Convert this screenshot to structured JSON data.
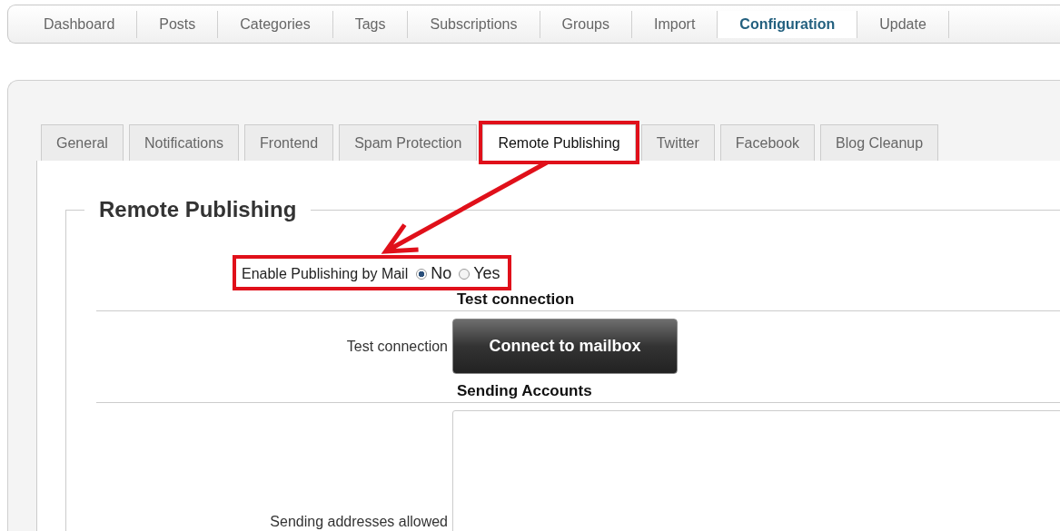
{
  "nav": [
    {
      "label": "Dashboard",
      "selected": false
    },
    {
      "label": "Posts",
      "selected": false
    },
    {
      "label": "Categories",
      "selected": false
    },
    {
      "label": "Tags",
      "selected": false
    },
    {
      "label": "Subscriptions",
      "selected": false
    },
    {
      "label": "Groups",
      "selected": false
    },
    {
      "label": "Import",
      "selected": false
    },
    {
      "label": "Configuration",
      "selected": true
    },
    {
      "label": "Update",
      "selected": false
    }
  ],
  "settings_tabs": [
    {
      "label": "General",
      "selected": false,
      "highlighted": false
    },
    {
      "label": "Notifications",
      "selected": false,
      "highlighted": false
    },
    {
      "label": "Frontend",
      "selected": false,
      "highlighted": false
    },
    {
      "label": "Spam Protection",
      "selected": false,
      "highlighted": false
    },
    {
      "label": "Remote Publishing",
      "selected": true,
      "highlighted": true
    },
    {
      "label": "Twitter",
      "selected": false,
      "highlighted": false
    },
    {
      "label": "Facebook",
      "selected": false,
      "highlighted": false
    },
    {
      "label": "Blog Cleanup",
      "selected": false,
      "highlighted": false
    }
  ],
  "fieldset": {
    "legend": "Remote Publishing"
  },
  "enable_field": {
    "label": "Enable Publishing by Mail",
    "highlighted": true,
    "options": [
      {
        "label": "No",
        "selected": true
      },
      {
        "label": "Yes",
        "selected": false
      }
    ]
  },
  "sections": [
    {
      "heading": "Test connection",
      "rows": [
        {
          "kind": "button",
          "label": "Test connection",
          "button": "Connect to mailbox"
        }
      ]
    },
    {
      "heading": "Sending Accounts",
      "rows": [
        {
          "kind": "textarea",
          "label": "Sending addresses allowed"
        }
      ]
    }
  ]
}
